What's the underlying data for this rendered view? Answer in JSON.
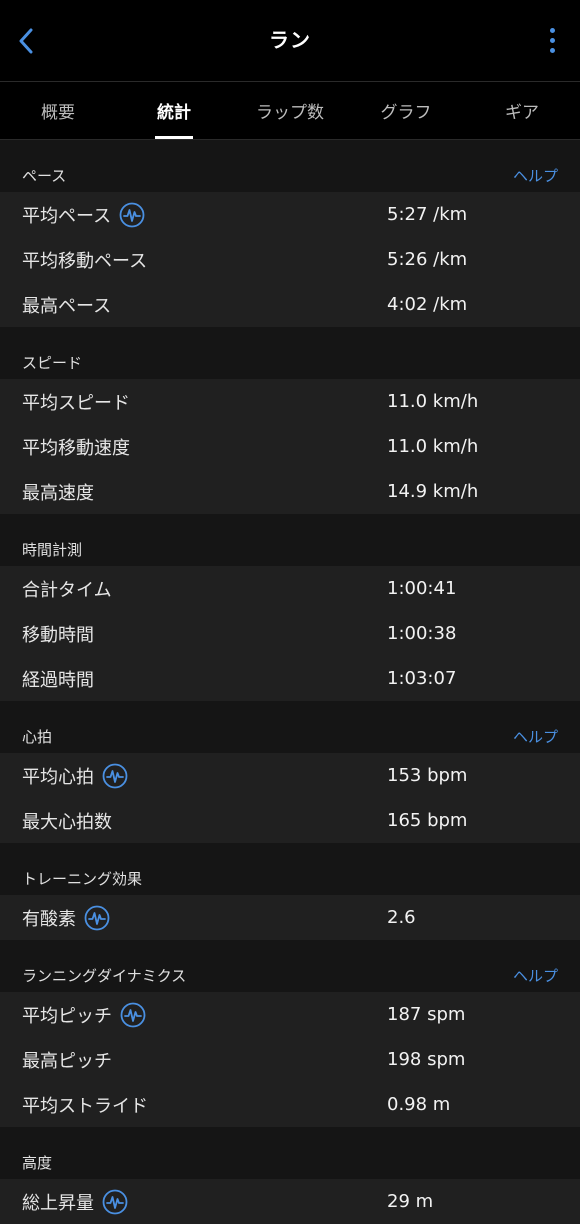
{
  "header": {
    "title": "ラン"
  },
  "tabs": [
    {
      "label": "概要",
      "active": false
    },
    {
      "label": "統計",
      "active": true
    },
    {
      "label": "ラップ数",
      "active": false
    },
    {
      "label": "グラフ",
      "active": false
    },
    {
      "label": "ギア",
      "active": false
    }
  ],
  "accent_color": "#4a90e2",
  "sections": {
    "pace": {
      "title": "ペース",
      "help": "ヘルプ",
      "rows": [
        {
          "label": "平均ペース",
          "value": "5:27 /km",
          "icon": "heart-wave-icon"
        },
        {
          "label": "平均移動ペース",
          "value": "5:26 /km"
        },
        {
          "label": "最高ペース",
          "value": "4:02 /km"
        }
      ]
    },
    "speed": {
      "title": "スピード",
      "rows": [
        {
          "label": "平均スピード",
          "value": "11.0 km/h"
        },
        {
          "label": "平均移動速度",
          "value": "11.0 km/h"
        },
        {
          "label": "最高速度",
          "value": "14.9 km/h"
        }
      ]
    },
    "timing": {
      "title": "時間計測",
      "rows": [
        {
          "label": "合計タイム",
          "value": "1:00:41"
        },
        {
          "label": "移動時間",
          "value": "1:00:38"
        },
        {
          "label": "経過時間",
          "value": "1:03:07"
        }
      ]
    },
    "heart": {
      "title": "心拍",
      "help": "ヘルプ",
      "rows": [
        {
          "label": "平均心拍",
          "value": "153 bpm",
          "icon": "heart-wave-icon"
        },
        {
          "label": "最大心拍数",
          "value": "165 bpm"
        }
      ]
    },
    "training": {
      "title": "トレーニング効果",
      "rows": [
        {
          "label": "有酸素",
          "value": "2.6",
          "icon": "heart-wave-icon"
        }
      ]
    },
    "dynamics": {
      "title": "ランニングダイナミクス",
      "help": "ヘルプ",
      "rows": [
        {
          "label": "平均ピッチ",
          "value": "187 spm",
          "icon": "heart-wave-icon"
        },
        {
          "label": "最高ピッチ",
          "value": "198 spm"
        },
        {
          "label": "平均ストライド",
          "value": "0.98 m"
        }
      ]
    },
    "elevation": {
      "title": "高度",
      "rows": [
        {
          "label": "総上昇量",
          "value": "29 m",
          "icon": "heart-wave-icon"
        }
      ]
    }
  }
}
